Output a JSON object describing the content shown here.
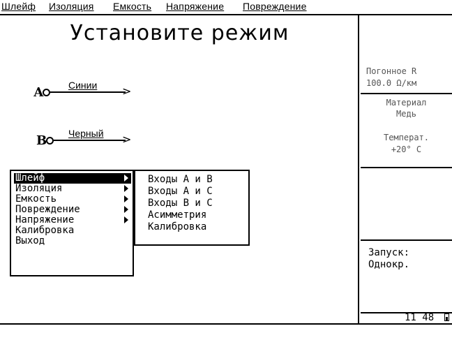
{
  "menubar": {
    "items": [
      {
        "label": "Шлейф"
      },
      {
        "label": "Изоляция"
      },
      {
        "label": "Емкость"
      },
      {
        "label": "Напряжение"
      },
      {
        "label": "Повреждение"
      }
    ]
  },
  "main": {
    "title": "Установите режим",
    "terminals": [
      {
        "letter": "А",
        "wire_label": "Синии"
      },
      {
        "letter": "В",
        "wire_label": "Черный"
      }
    ]
  },
  "mode_menu": {
    "items": [
      {
        "label": "Шлейф",
        "has_submenu": true,
        "selected": true
      },
      {
        "label": "Изоляция",
        "has_submenu": true,
        "selected": false
      },
      {
        "label": "Емкость",
        "has_submenu": true,
        "selected": false
      },
      {
        "label": "Повреждение",
        "has_submenu": true,
        "selected": false
      },
      {
        "label": "Напряжение",
        "has_submenu": true,
        "selected": false
      },
      {
        "label": "Калибровка",
        "has_submenu": false,
        "selected": false
      },
      {
        "label": "Выход",
        "has_submenu": false,
        "selected": false
      }
    ]
  },
  "submenu": {
    "items": [
      {
        "label": "Входы А и В"
      },
      {
        "label": "Входы А и С"
      },
      {
        "label": "Входы В и С"
      },
      {
        "label": "Асимметрия"
      },
      {
        "label": "Калибровка"
      }
    ]
  },
  "right_panel": {
    "resistance_label": "Погонное R",
    "resistance_value": "100.0 Ω/км",
    "material_label": "Материал",
    "material_value": "Медь",
    "temperature_label": "Температ.",
    "temperature_value": "+20° С",
    "launch_label": "Запуск:",
    "launch_value": "Однокр.",
    "clock": "11 48",
    "clock_icon": "battery-icon"
  }
}
